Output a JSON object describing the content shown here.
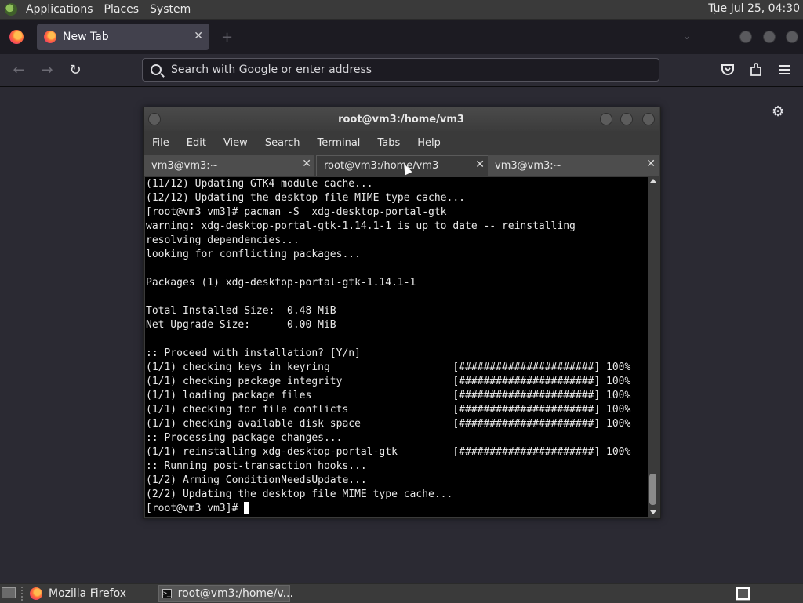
{
  "top_panel": {
    "menus": [
      "Applications",
      "Places",
      "System"
    ],
    "clock": "Tue Jul 25, 04:30"
  },
  "browser": {
    "tab_title": "New Tab",
    "tab_close": "✕",
    "new_tab": "+",
    "tab_list": "⌄",
    "nav": {
      "back": "←",
      "forward": "→",
      "reload": "↻"
    },
    "url_placeholder": "Search with Google or enter address",
    "toolbar_icons": [
      "pocket-icon",
      "extensions-icon",
      "menu-icon"
    ],
    "settings_icon": "⚙"
  },
  "terminal": {
    "title": "root@vm3:/home/vm3",
    "menu": [
      "File",
      "Edit",
      "View",
      "Search",
      "Terminal",
      "Tabs",
      "Help"
    ],
    "tabs": [
      {
        "label": "vm3@vm3:~",
        "active": false
      },
      {
        "label": "root@vm3:/home/vm3",
        "active": true
      },
      {
        "label": "vm3@vm3:~",
        "active": false
      }
    ],
    "tab_close": "✕",
    "lines": [
      "(11/12) Updating GTK4 module cache...",
      "(12/12) Updating the desktop file MIME type cache...",
      "[root@vm3 vm3]# pacman -S  xdg-desktop-portal-gtk",
      "warning: xdg-desktop-portal-gtk-1.14.1-1 is up to date -- reinstalling",
      "resolving dependencies...",
      "looking for conflicting packages...",
      "",
      "Packages (1) xdg-desktop-portal-gtk-1.14.1-1",
      "",
      "Total Installed Size:  0.48 MiB",
      "Net Upgrade Size:      0.00 MiB",
      "",
      ":: Proceed with installation? [Y/n]",
      "(1/1) checking keys in keyring                    [######################] 100%",
      "(1/1) checking package integrity                  [######################] 100%",
      "(1/1) loading package files                       [######################] 100%",
      "(1/1) checking for file conflicts                 [######################] 100%",
      "(1/1) checking available disk space               [######################] 100%",
      ":: Processing package changes...",
      "(1/1) reinstalling xdg-desktop-portal-gtk         [######################] 100%",
      ":: Running post-transaction hooks...",
      "(1/2) Arming ConditionNeedsUpdate...",
      "(2/2) Updating the desktop file MIME type cache..."
    ],
    "prompt": "[root@vm3 vm3]# "
  },
  "taskbar": {
    "items": [
      {
        "label": "Mozilla Firefox",
        "icon": "firefox-icon"
      },
      {
        "label": "root@vm3:/home/v...",
        "icon": "terminal-icon"
      }
    ]
  },
  "colors": {
    "browser_bg": "#2b2a33",
    "tab_active": "#42414d",
    "terminal_bg": "#000000",
    "panel_bg": "#3a3a3a"
  }
}
